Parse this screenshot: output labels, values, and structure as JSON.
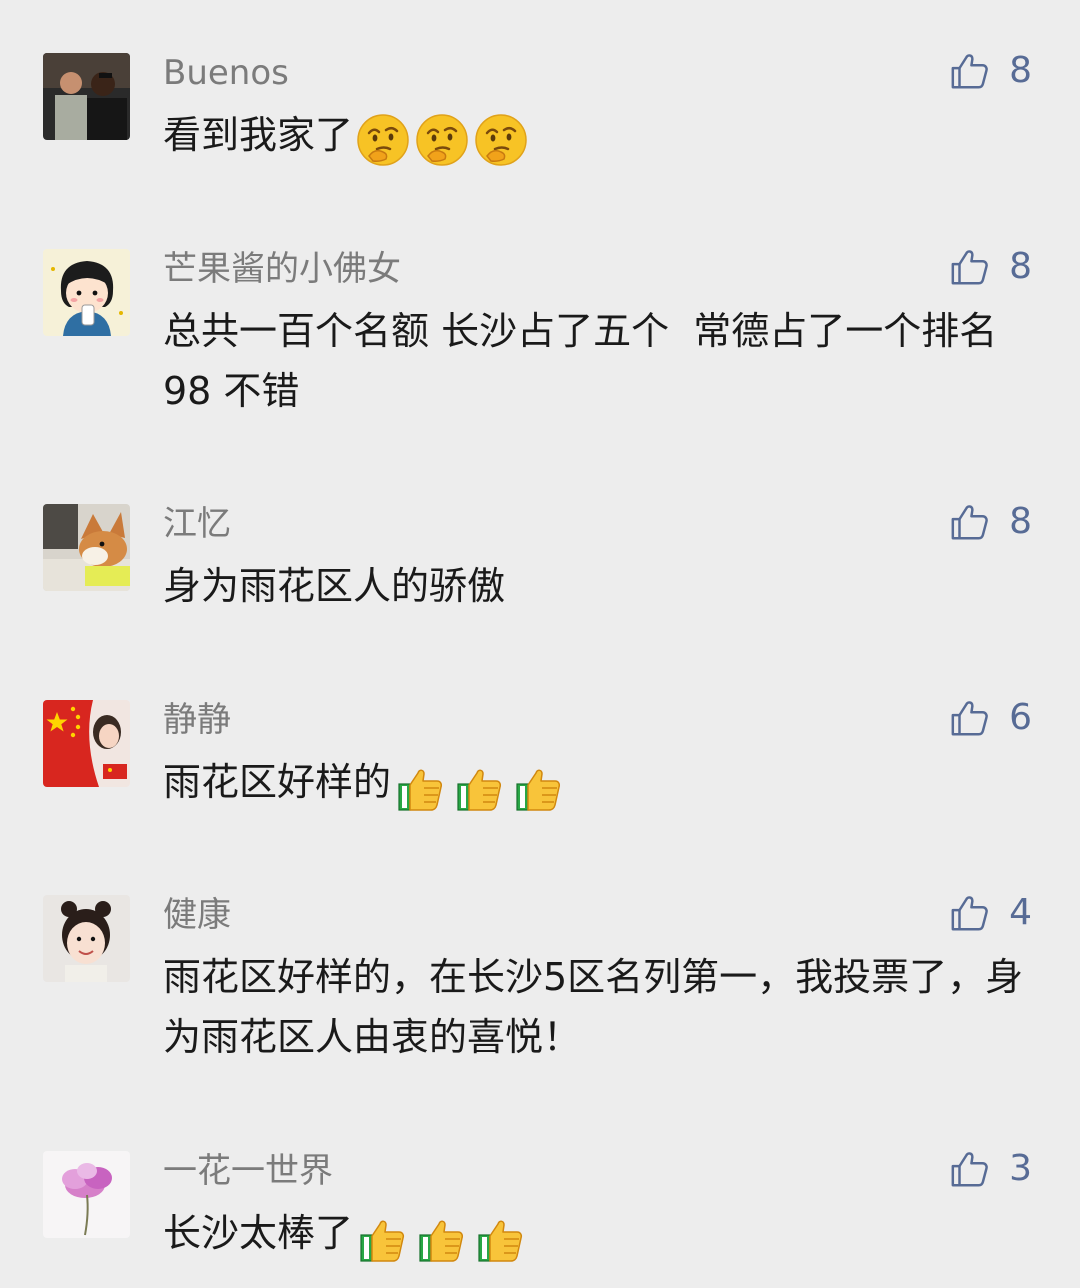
{
  "colors": {
    "background": "#ededed",
    "nickname": "#7b7b7b",
    "text": "#1a1a1a",
    "like_accent": "#576b95"
  },
  "comments": [
    {
      "avatar": "avatar-two-men-photo",
      "nickname": "Buenos",
      "text": "看到我家了",
      "emoji": "thinking-face-emoji",
      "emoji_count": 3,
      "likes": "8"
    },
    {
      "avatar": "avatar-cartoon-girl-drinking",
      "nickname": "芒果酱的小佛女",
      "text": "总共一百个名额 长沙占了五个  常德占了一个排名98 不错",
      "emoji": "",
      "emoji_count": 0,
      "likes": "8"
    },
    {
      "avatar": "avatar-corgi-dog-photo",
      "nickname": "江忆",
      "text": "身为雨花区人的骄傲",
      "emoji": "",
      "emoji_count": 0,
      "likes": "8"
    },
    {
      "avatar": "avatar-chinese-flag-girl",
      "nickname": "静静",
      "text": "雨花区好样的",
      "emoji": "thumbs-up-emoji",
      "emoji_count": 3,
      "likes": "6"
    },
    {
      "avatar": "avatar-little-girl-photo",
      "nickname": "健康",
      "text": "雨花区好样的，在长沙5区名列第一，我投票了，身为雨花区人由衷的喜悦！",
      "emoji": "",
      "emoji_count": 0,
      "likes": "4"
    },
    {
      "avatar": "avatar-pink-flower",
      "nickname": "一花一世界",
      "text": "长沙太棒了",
      "emoji": "thumbs-up-emoji",
      "emoji_count": 3,
      "likes": "3"
    }
  ]
}
